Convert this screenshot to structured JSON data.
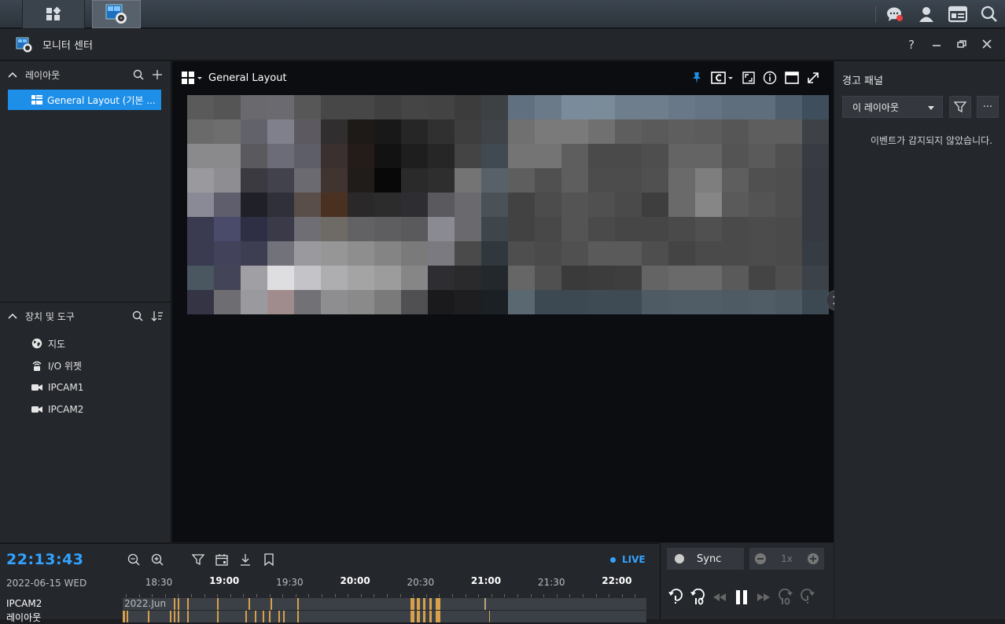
{
  "app": {
    "title": "모니터 센터"
  },
  "window_controls": {
    "help": "?"
  },
  "layout_section": {
    "header": "레이아웃",
    "items": [
      {
        "label": "General Layout (기본 ..."
      }
    ]
  },
  "devices_section": {
    "header": "장치 및 도구",
    "items": [
      {
        "label": "지도",
        "icon": "globe-icon"
      },
      {
        "label": "I/O 위젯",
        "icon": "io-widget-icon"
      },
      {
        "label": "IPCAM1",
        "icon": "camera-icon"
      },
      {
        "label": "IPCAM2",
        "icon": "camera-icon"
      }
    ]
  },
  "view": {
    "layout_name": "General Layout"
  },
  "alert_panel": {
    "title": "경고 패널",
    "filter_select": "이 레이아웃",
    "more": "···",
    "empty_message": "이벤트가 감지되지 않았습니다."
  },
  "timeline": {
    "clock": "22:13:43",
    "date": "2022-06-15 WED",
    "live_label": "LIVE",
    "times": [
      {
        "label": "18:30",
        "major": false
      },
      {
        "label": "19:00",
        "major": true
      },
      {
        "label": "19:30",
        "major": false
      },
      {
        "label": "20:00",
        "major": true
      },
      {
        "label": "20:30",
        "major": false
      },
      {
        "label": "21:00",
        "major": true
      },
      {
        "label": "21:30",
        "major": false
      },
      {
        "label": "22:00",
        "major": true
      }
    ],
    "tracks": [
      {
        "label": "IPCAM2",
        "month_label": "2022.Jun"
      },
      {
        "label": "레이아웃"
      }
    ]
  },
  "playback": {
    "sync_label": "Sync",
    "speed_label": "1x"
  },
  "colors": {
    "accent": "#1e8fe8",
    "live": "#33a3ff",
    "event_marker": "#d9a04c"
  }
}
